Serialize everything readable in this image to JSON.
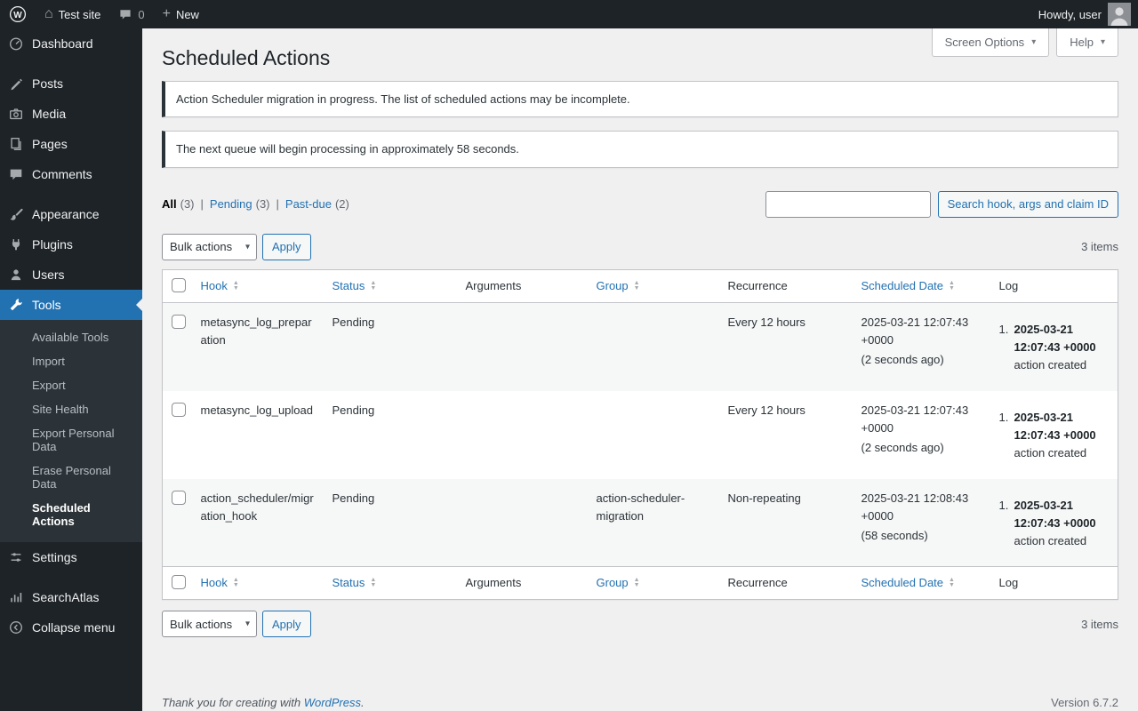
{
  "colors": {
    "accent": "#2271b1",
    "dark_bg": "#1d2327",
    "submenu_bg": "#2c3338",
    "page_bg": "#f0f0f1",
    "border": "#c3c4c7",
    "notice_border": "#2c3338"
  },
  "icons": {
    "plus": "+",
    "chevron_down": "▾",
    "sort_asc": "▲",
    "sort_desc": "▼"
  },
  "admin_bar": {
    "site_name": "Test site",
    "comments_count": "0",
    "new_label": "New",
    "howdy_text": "Howdy, user"
  },
  "sidebar": {
    "menu": [
      {
        "label": "Dashboard"
      },
      {
        "label": "Posts"
      },
      {
        "label": "Media"
      },
      {
        "label": "Pages"
      },
      {
        "label": "Comments"
      },
      {
        "label": "Appearance"
      },
      {
        "label": "Plugins"
      },
      {
        "label": "Users"
      },
      {
        "label": "Tools"
      },
      {
        "label": "Settings"
      },
      {
        "label": "SearchAtlas"
      },
      {
        "label": "Collapse menu"
      }
    ],
    "tools_submenu": [
      {
        "label": "Available Tools"
      },
      {
        "label": "Import"
      },
      {
        "label": "Export"
      },
      {
        "label": "Site Health"
      },
      {
        "label": "Export Personal Data"
      },
      {
        "label": "Erase Personal Data"
      },
      {
        "label": "Scheduled Actions"
      }
    ]
  },
  "screen_meta": {
    "screen_options_label": "Screen Options",
    "help_label": "Help"
  },
  "page": {
    "title": "Scheduled Actions"
  },
  "notices": [
    {
      "text": "Action Scheduler migration in progress. The list of scheduled actions may be incomplete."
    },
    {
      "text": "The next queue will begin processing in approximately 58 seconds."
    }
  ],
  "filters": {
    "separator": "|",
    "views": [
      {
        "label": "All",
        "count": "(3)"
      },
      {
        "label": "Pending",
        "count": "(3)"
      },
      {
        "label": "Past-due",
        "count": "(2)"
      }
    ]
  },
  "search": {
    "button_label": "Search hook, args and claim ID"
  },
  "bulk_actions": {
    "select_value": "Bulk actions",
    "apply_label": "Apply"
  },
  "items_count": "3 items",
  "table": {
    "headers": {
      "hook": "Hook",
      "status": "Status",
      "arguments": "Arguments",
      "group": "Group",
      "recurrence": "Recurrence",
      "scheduled_date": "Scheduled Date",
      "log": "Log"
    },
    "rows": [
      {
        "hook": "metasync_log_preparation",
        "status": "Pending",
        "arguments": "",
        "group": "",
        "recurrence": "Every 12 hours",
        "scheduled_date": "2025-03-21 12:07:43 +0000",
        "scheduled_note": "(2 seconds ago)",
        "log_index": "1.",
        "log_date": "2025-03-21 12:07:43 +0000",
        "log_text": "action created"
      },
      {
        "hook": "metasync_log_upload",
        "status": "Pending",
        "arguments": "",
        "group": "",
        "recurrence": "Every 12 hours",
        "scheduled_date": "2025-03-21 12:07:43 +0000",
        "scheduled_note": "(2 seconds ago)",
        "log_index": "1.",
        "log_date": "2025-03-21 12:07:43 +0000",
        "log_text": "action created"
      },
      {
        "hook": "action_scheduler/migration_hook",
        "status": "Pending",
        "arguments": "",
        "group": "action-scheduler-migration",
        "recurrence": "Non-repeating",
        "scheduled_date": "2025-03-21 12:08:43 +0000",
        "scheduled_note": "(58 seconds)",
        "log_index": "1.",
        "log_date": "2025-03-21 12:07:43 +0000",
        "log_text": "action created"
      }
    ]
  },
  "footer": {
    "thanks_text": "Thank you for creating with",
    "wordpress_label": "WordPress",
    "suffix": ".",
    "version": "Version 6.7.2"
  }
}
